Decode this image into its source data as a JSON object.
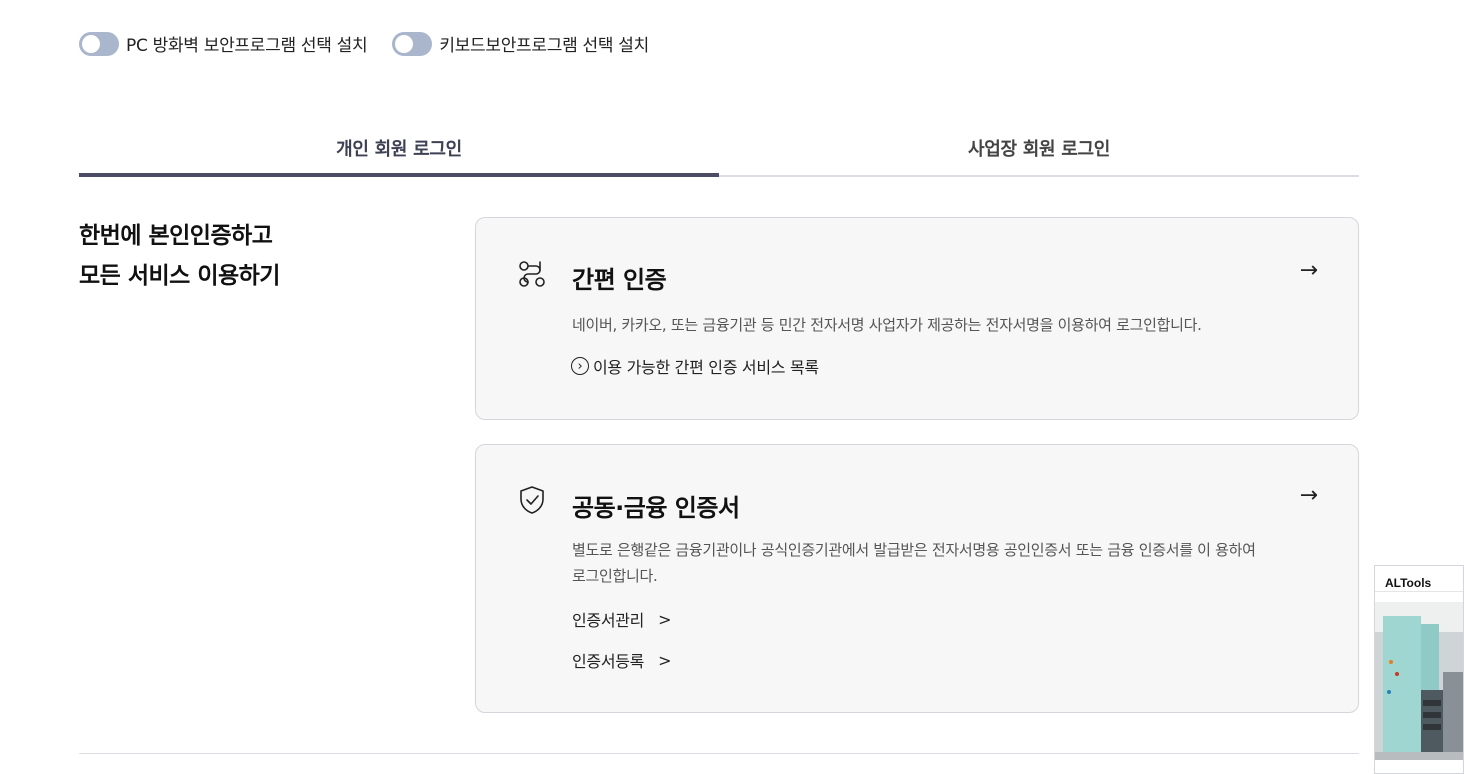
{
  "security_toggles": [
    {
      "label": "PC 방화벽 보안프로그램 선택 설치"
    },
    {
      "label": "키보드보안프로그램 선택 설치"
    }
  ],
  "tabs": [
    {
      "label": "개인 회원 로그인",
      "active": true
    },
    {
      "label": "사업장 회원 로그인",
      "active": false
    }
  ],
  "intro": {
    "line1": "한번에 본인인증하고",
    "line2": "모든 서비스 이용하기"
  },
  "cards": {
    "simple_auth": {
      "title": "간편 인증",
      "description": "네이버, 카카오, 또는 금융기관 등 민간 전자서명 사업자가 제공하는 전자서명을 이용하여 로그인합니다.",
      "link": "이용 가능한 간편 인증 서비스 목록",
      "arrow": "→",
      "icon": "route-icon"
    },
    "certificate": {
      "title": "공동·금융 인증서",
      "description": "별도로 은행같은 금융기관이나 공식인증기관에서 발급받은 전자서명용 공인인증서 또는 금융 인증서를 이 용하여 로그인합니다.",
      "links": [
        "인증서관리",
        "인증서등록"
      ],
      "arrow": "→",
      "icon": "shield-check-icon"
    }
  },
  "ad": {
    "title": "ALTools"
  },
  "colors": {
    "toggle_off": "#a9b6cc",
    "tab_active": "#4a4d63",
    "card_bg": "#f7f7f7",
    "border": "#d5d6db"
  }
}
